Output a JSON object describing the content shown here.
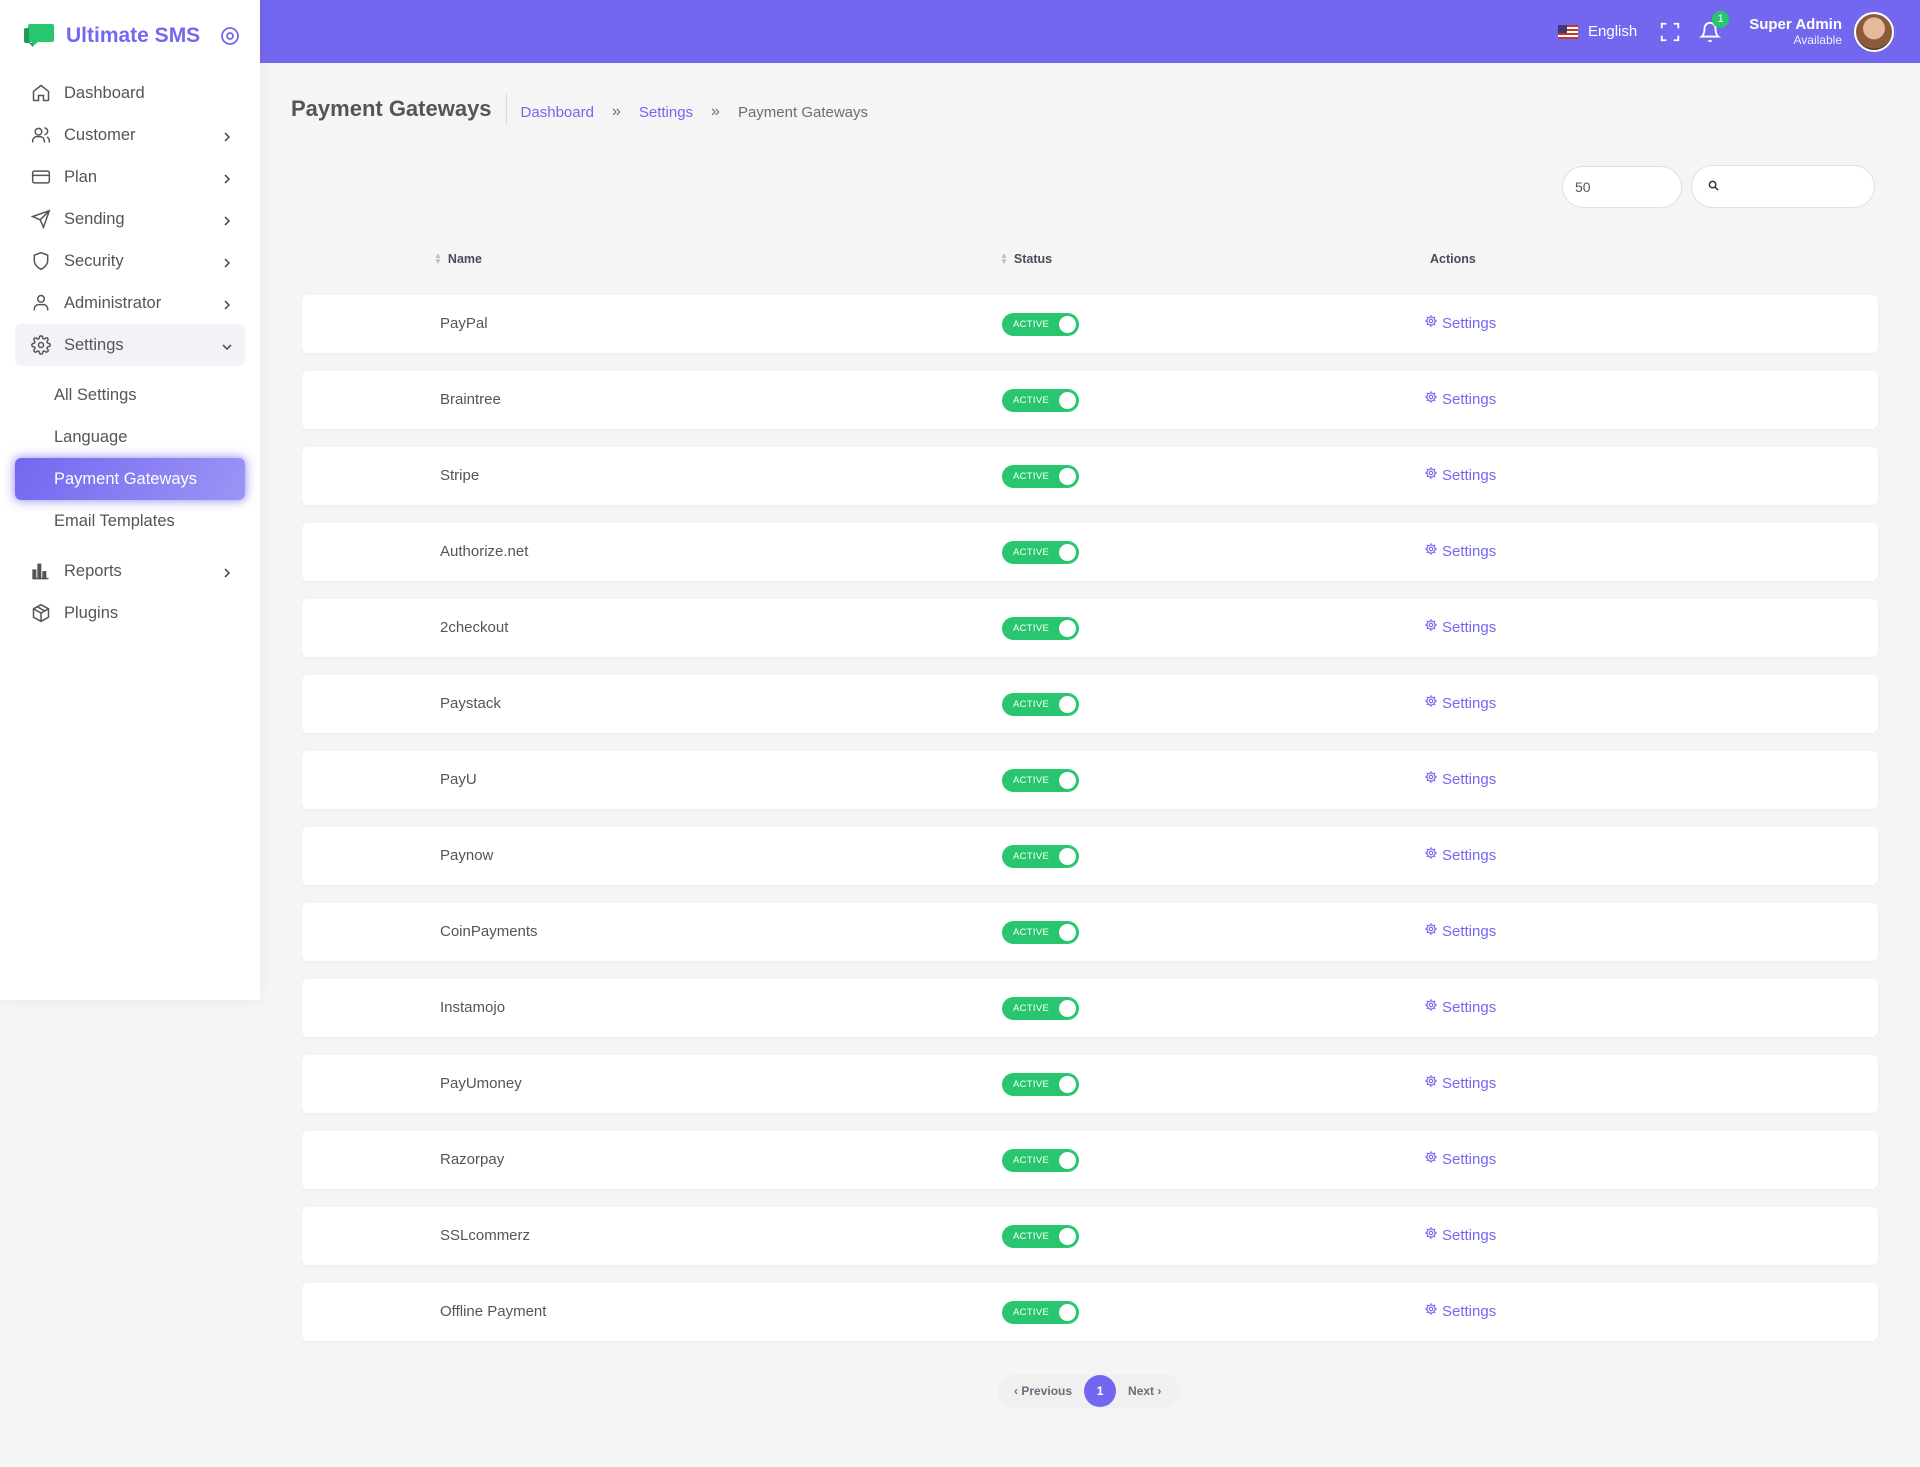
{
  "brand": {
    "name": "Ultimate SMS",
    "logo_color": "#28c76f"
  },
  "sidebar": {
    "items": [
      {
        "label": "Dashboard",
        "icon": "home-icon",
        "has_children": false
      },
      {
        "label": "Customer",
        "icon": "users-icon",
        "has_children": true
      },
      {
        "label": "Plan",
        "icon": "credit-card-icon",
        "has_children": true
      },
      {
        "label": "Sending",
        "icon": "send-icon",
        "has_children": true
      },
      {
        "label": "Security",
        "icon": "shield-icon",
        "has_children": true
      },
      {
        "label": "Administrator",
        "icon": "user-icon",
        "has_children": true
      },
      {
        "label": "Settings",
        "icon": "gear-icon",
        "has_children": true,
        "open": true
      }
    ],
    "settings_sub": [
      "All Settings",
      "Language",
      "Payment Gateways",
      "Email Templates"
    ],
    "active_sub": "Payment Gateways",
    "bottom_items": [
      {
        "label": "Reports",
        "icon": "bar-chart-icon",
        "has_children": true
      },
      {
        "label": "Plugins",
        "icon": "package-icon",
        "has_children": false
      }
    ]
  },
  "navbar": {
    "language": "English",
    "notification_count": "1",
    "user_name": "Super Admin",
    "user_status": "Available",
    "bg_color": "#7367f0"
  },
  "header": {
    "title": "Payment Gateways",
    "breadcrumbs": [
      "Dashboard",
      "Settings",
      "Payment Gateways"
    ],
    "separator": "»"
  },
  "controls": {
    "page_length": "50",
    "search_placeholder": ""
  },
  "table": {
    "columns": [
      "Name",
      "Status",
      "Actions"
    ],
    "rows": [
      {
        "name": "PayPal",
        "status": "ACTIVE",
        "action": "Settings"
      },
      {
        "name": "Braintree",
        "status": "ACTIVE",
        "action": "Settings"
      },
      {
        "name": "Stripe",
        "status": "ACTIVE",
        "action": "Settings"
      },
      {
        "name": "Authorize.net",
        "status": "ACTIVE",
        "action": "Settings"
      },
      {
        "name": "2checkout",
        "status": "ACTIVE",
        "action": "Settings"
      },
      {
        "name": "Paystack",
        "status": "ACTIVE",
        "action": "Settings"
      },
      {
        "name": "PayU",
        "status": "ACTIVE",
        "action": "Settings"
      },
      {
        "name": "Paynow",
        "status": "ACTIVE",
        "action": "Settings"
      },
      {
        "name": "CoinPayments",
        "status": "ACTIVE",
        "action": "Settings"
      },
      {
        "name": "Instamojo",
        "status": "ACTIVE",
        "action": "Settings"
      },
      {
        "name": "PayUmoney",
        "status": "ACTIVE",
        "action": "Settings"
      },
      {
        "name": "Razorpay",
        "status": "ACTIVE",
        "action": "Settings"
      },
      {
        "name": "SSLcommerz",
        "status": "ACTIVE",
        "action": "Settings"
      },
      {
        "name": "Offline Payment",
        "status": "ACTIVE",
        "action": "Settings"
      }
    ]
  },
  "pagination": {
    "previous": "Previous",
    "current": "1",
    "next": "Next"
  },
  "colors": {
    "accent": "#7367f0",
    "success": "#28c76f"
  }
}
